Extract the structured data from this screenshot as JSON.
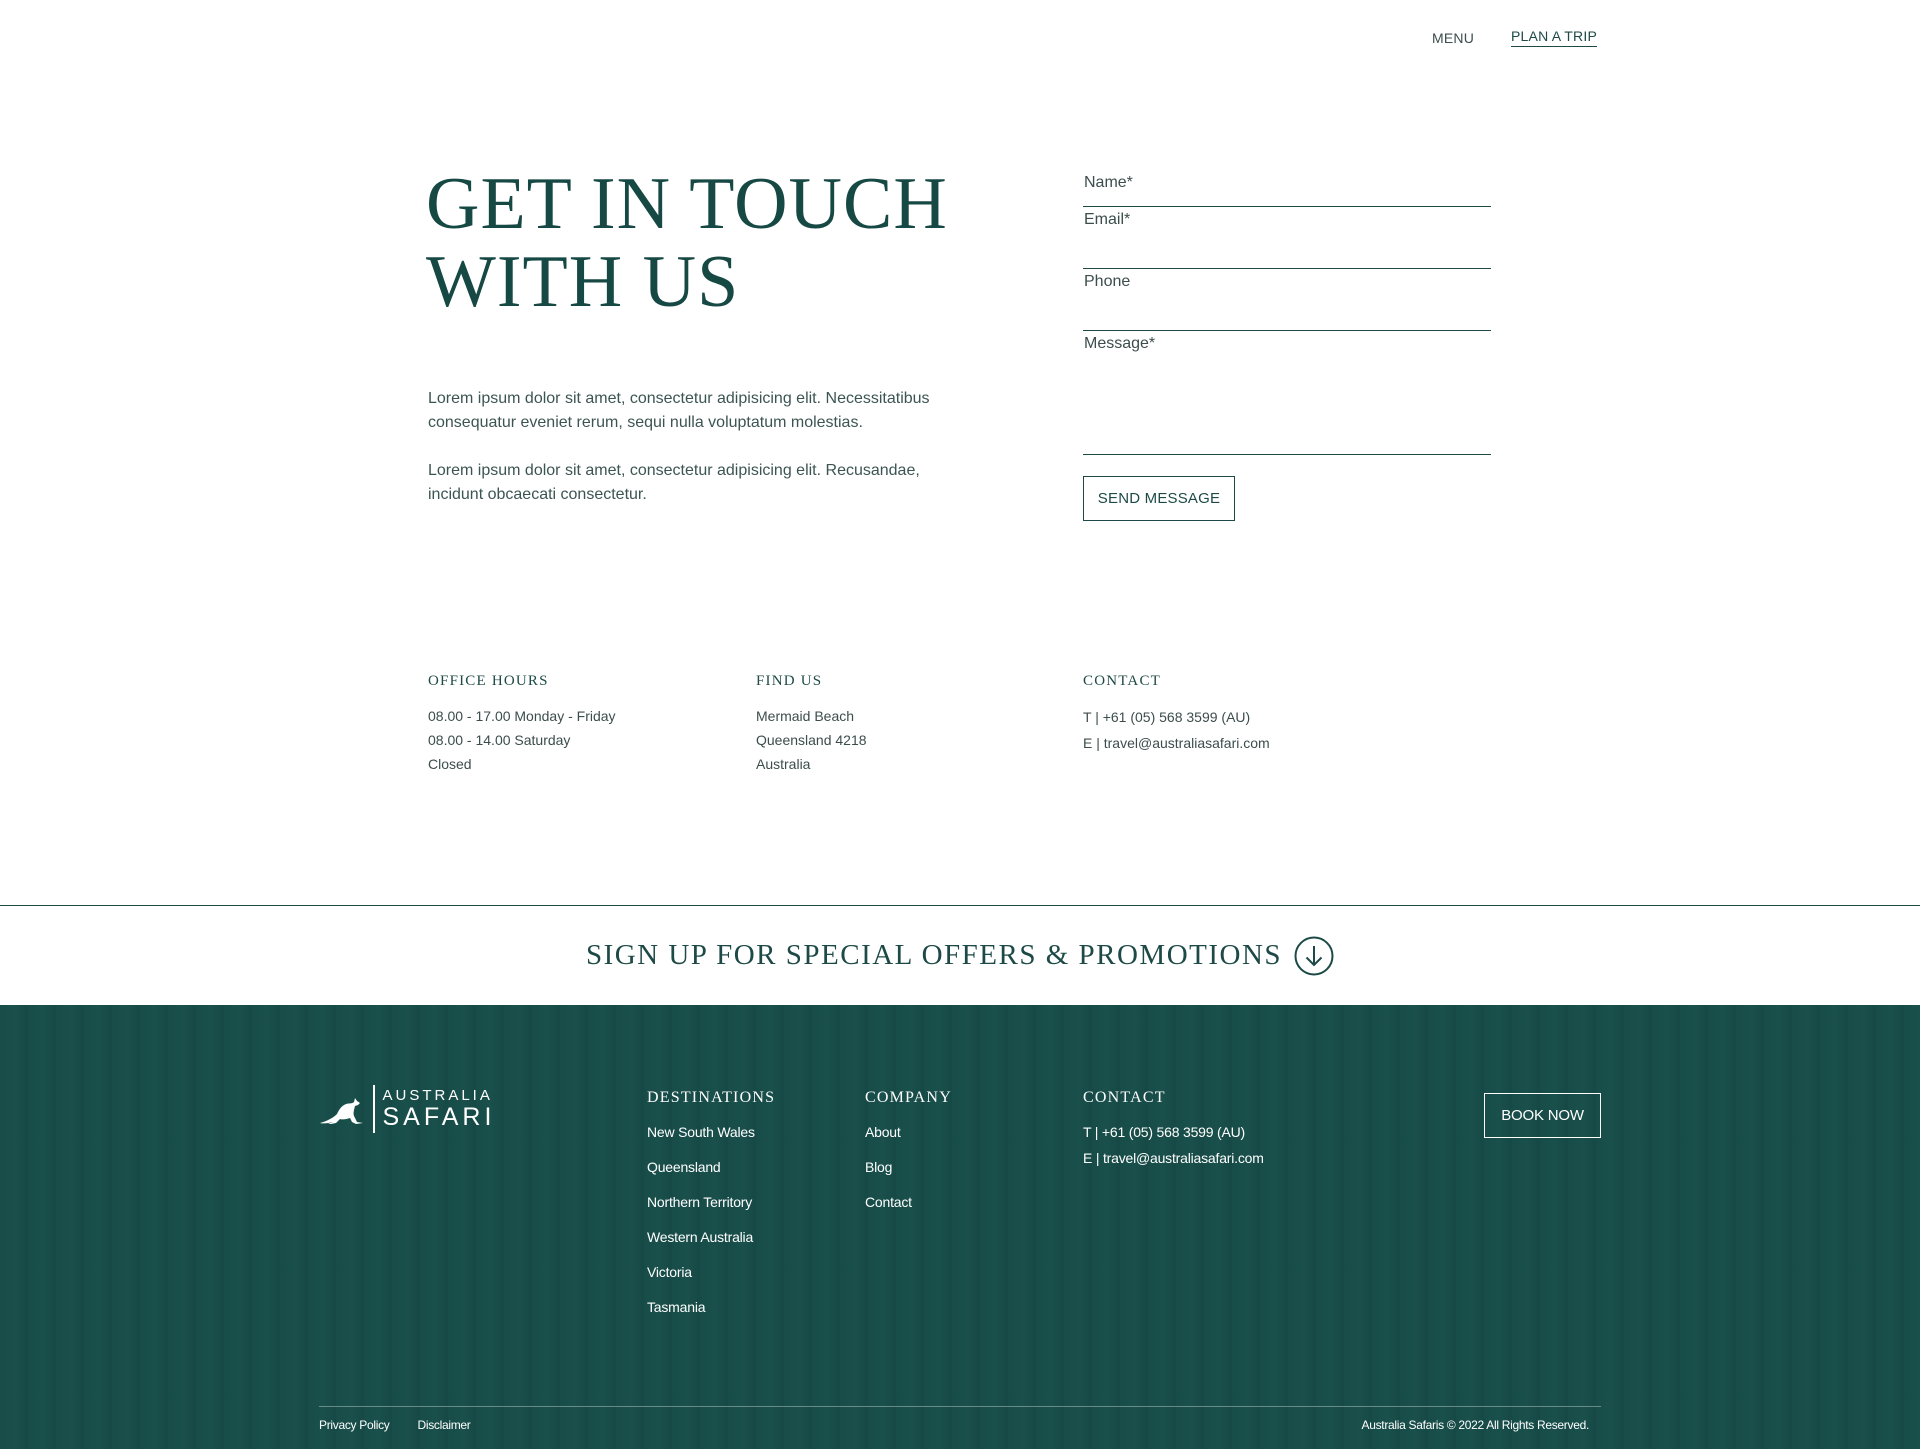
{
  "nav": {
    "menu_label": "MENU",
    "plan_label": "PLAN A TRIP"
  },
  "hero": {
    "title_line1": "GET IN TOUCH",
    "title_line2": "WITH US",
    "paragraph1": "Lorem ipsum dolor sit amet, consectetur adipisicing elit. Necessitatibus consequatur eveniet rerum, sequi nulla voluptatum molestias.",
    "paragraph2": "Lorem ipsum dolor sit amet, consectetur adipisicing elit. Recusandae, incidunt obcaecati consectetur."
  },
  "form": {
    "name_placeholder": "Name*",
    "email_placeholder": "Email*",
    "phone_placeholder": "Phone",
    "message_placeholder": "Message*",
    "submit_label": "SEND MESSAGE"
  },
  "info": {
    "hours": {
      "title": "OFFICE HOURS",
      "lines": [
        "08.00 - 17.00 Monday - Friday",
        "08.00 - 14.00 Saturday",
        "Closed"
      ]
    },
    "find": {
      "title": "FIND US",
      "lines": [
        "Mermaid Beach",
        "Queensland 4218",
        "Australia"
      ]
    },
    "contact": {
      "title": "CONTACT",
      "lines": [
        "T | +61 (05) 568 3599 (AU)",
        "E | travel@australiasafari.com"
      ]
    }
  },
  "signup": {
    "label": "SIGN UP FOR SPECIAL OFFERS & PROMOTIONS",
    "icon": "arrow-down-circle-icon"
  },
  "footer": {
    "logo": {
      "line1": "AUSTRALIA",
      "line2": "SAFARI",
      "icon": "kangaroo-icon"
    },
    "destinations": {
      "title": "DESTINATIONS",
      "items": [
        "New South Wales",
        "Queensland",
        "Northern Territory",
        "Western Australia",
        "Victoria",
        "Tasmania"
      ]
    },
    "company": {
      "title": "COMPANY",
      "items": [
        "About",
        "Blog",
        "Contact"
      ]
    },
    "contact": {
      "title": "CONTACT",
      "lines": [
        "T | +61 (05) 568 3599 (AU)",
        "E | travel@australiasafari.com"
      ]
    },
    "book_label": "BOOK NOW",
    "bottom_links": [
      "Privacy Policy",
      "Disclaimer"
    ],
    "copyright": "Australia Safaris © 2022 All Rights Reserved."
  },
  "colors": {
    "brand_green": "#1d4a46",
    "footer_bg": "#174c48",
    "text_gray": "#3c4d4c"
  }
}
